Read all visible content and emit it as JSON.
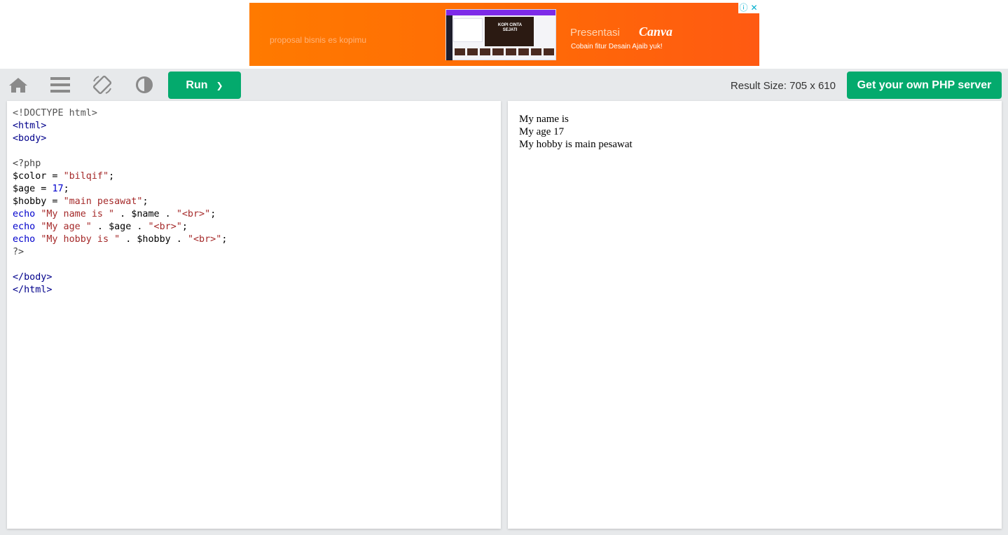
{
  "ad": {
    "tagline": "proposal bisnis es kopimu",
    "preview_title": "Canva",
    "preview_canvas_text": "KOPI CINTA SEJATI",
    "headline": "Presentasi",
    "brand": "Canva",
    "cta": "Cobain fitur Desain Ajaib yuk!",
    "info_icon": "ⓘ",
    "close_icon": "✕"
  },
  "toolbar": {
    "home_icon": "home-icon",
    "menu_icon": "menu-icon",
    "rotate_icon": "rotate-icon",
    "theme_icon": "contrast-icon",
    "run_label": "Run",
    "run_chevron": "❯",
    "result_size": "Result Size: 705 x 610",
    "server_label": "Get your own PHP server"
  },
  "colors": {
    "accent": "#04aa6d",
    "toolbar_bg": "#e7e9eb",
    "tag": "#00008b",
    "string": "#a52a2a",
    "keyword": "#0000cd"
  },
  "editor": {
    "lines": [
      [
        {
          "t": "<!DOCTYPE html>",
          "c": "doc"
        }
      ],
      [
        {
          "t": "<html>",
          "c": "tag"
        }
      ],
      [
        {
          "t": "<body>",
          "c": "tag"
        }
      ],
      [],
      [
        {
          "t": "<?php",
          "c": "php"
        }
      ],
      [
        {
          "t": "$color",
          "c": "var"
        },
        {
          "t": " = ",
          "c": "op"
        },
        {
          "t": "\"bilqif\"",
          "c": "str"
        },
        {
          "t": ";",
          "c": "op"
        }
      ],
      [
        {
          "t": "$age",
          "c": "var"
        },
        {
          "t": " = ",
          "c": "op"
        },
        {
          "t": "17",
          "c": "num"
        },
        {
          "t": ";",
          "c": "op"
        }
      ],
      [
        {
          "t": "$hobby",
          "c": "var"
        },
        {
          "t": " = ",
          "c": "op"
        },
        {
          "t": "\"main pesawat\"",
          "c": "str"
        },
        {
          "t": ";",
          "c": "op"
        }
      ],
      [
        {
          "t": "echo",
          "c": "kw"
        },
        {
          "t": " ",
          "c": "op"
        },
        {
          "t": "\"My name is \"",
          "c": "str"
        },
        {
          "t": " . ",
          "c": "op"
        },
        {
          "t": "$name",
          "c": "var"
        },
        {
          "t": " . ",
          "c": "op"
        },
        {
          "t": "\"<br>\"",
          "c": "str"
        },
        {
          "t": ";",
          "c": "op"
        }
      ],
      [
        {
          "t": "echo",
          "c": "kw"
        },
        {
          "t": " ",
          "c": "op"
        },
        {
          "t": "\"My age \"",
          "c": "str"
        },
        {
          "t": " . ",
          "c": "op"
        },
        {
          "t": "$age",
          "c": "var"
        },
        {
          "t": " . ",
          "c": "op"
        },
        {
          "t": "\"<br>\"",
          "c": "str"
        },
        {
          "t": ";",
          "c": "op"
        }
      ],
      [
        {
          "t": "echo",
          "c": "kw"
        },
        {
          "t": " ",
          "c": "op"
        },
        {
          "t": "\"My hobby is \"",
          "c": "str"
        },
        {
          "t": " . ",
          "c": "op"
        },
        {
          "t": "$hobby",
          "c": "var"
        },
        {
          "t": " . ",
          "c": "op"
        },
        {
          "t": "\"<br>\"",
          "c": "str"
        },
        {
          "t": ";",
          "c": "op"
        }
      ],
      [
        {
          "t": "?>",
          "c": "php"
        }
      ],
      [],
      [
        {
          "t": "</body>",
          "c": "tag"
        }
      ],
      [
        {
          "t": "</html>",
          "c": "tag"
        }
      ]
    ]
  },
  "result": {
    "output_lines": [
      "My name is",
      "My age 17",
      "My hobby is main pesawat"
    ]
  }
}
